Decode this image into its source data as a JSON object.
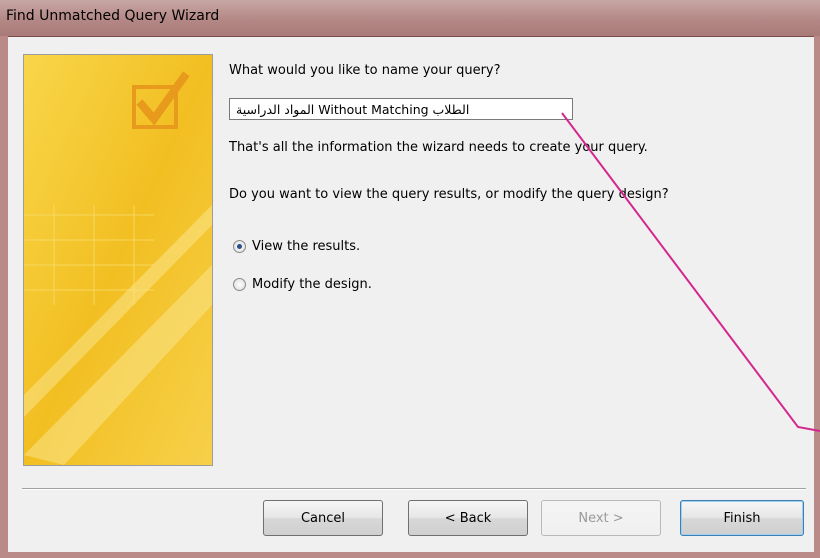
{
  "window": {
    "title": "Find Unmatched Query Wizard"
  },
  "prompt": {
    "question": "What would you like to name your query?",
    "info": "That's all the information the wizard needs to create your query.",
    "choice_question": "Do you want to view the query results, or modify the query design?"
  },
  "query_name": {
    "value": "الطلاب Without Matching المواد الدراسية"
  },
  "options": [
    {
      "label": "View the results.",
      "selected": true
    },
    {
      "label": "Modify the design.",
      "selected": false
    }
  ],
  "buttons": {
    "cancel": "Cancel",
    "back": "< Back",
    "next": "Next >",
    "finish": "Finish"
  },
  "colors": {
    "banner": "#f5c832",
    "annotation_arrow": "#d4278e"
  }
}
